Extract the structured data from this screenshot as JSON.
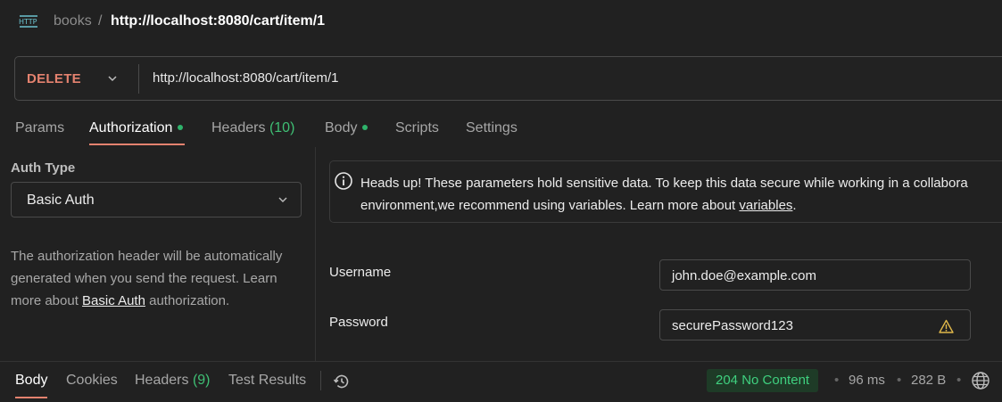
{
  "header": {
    "icon": "http-icon",
    "icon_text": "HTTP",
    "breadcrumb_parent": "books",
    "breadcrumb_sep": "/",
    "breadcrumb_current": "http://localhost:8080/cart/item/1"
  },
  "request": {
    "method": "DELETE",
    "url": "http://localhost:8080/cart/item/1"
  },
  "tabs": [
    {
      "label": "Params"
    },
    {
      "label": "Authorization",
      "active": true,
      "dot": true
    },
    {
      "label": "Headers",
      "count": "(10)"
    },
    {
      "label": "Body",
      "dot": true
    },
    {
      "label": "Scripts"
    },
    {
      "label": "Settings"
    }
  ],
  "auth": {
    "type_label": "Auth Type",
    "type_value": "Basic Auth",
    "description_before": "The authorization header will be automatically generated when you send the request. Learn more about ",
    "description_link": "Basic Auth",
    "description_after": " authorization."
  },
  "info": {
    "line1": "Heads up! These parameters hold sensitive data. To keep this data secure while working in a collabora",
    "line2_before": "environment,we recommend using variables. Learn more about ",
    "line2_link": "variables",
    "line2_after": "."
  },
  "fields": {
    "username_label": "Username",
    "username_value": "john.doe@example.com",
    "password_label": "Password",
    "password_value": "securePassword123"
  },
  "response": {
    "tabs": [
      {
        "label": "Body",
        "active": true
      },
      {
        "label": "Cookies"
      },
      {
        "label": "Headers",
        "count": "(9)"
      },
      {
        "label": "Test Results"
      }
    ],
    "status": "204 No Content",
    "time": "96 ms",
    "size": "282 B",
    "dot": "•"
  },
  "colors": {
    "accent": "#e4826f",
    "success": "#3fd07f",
    "background": "#212121"
  }
}
